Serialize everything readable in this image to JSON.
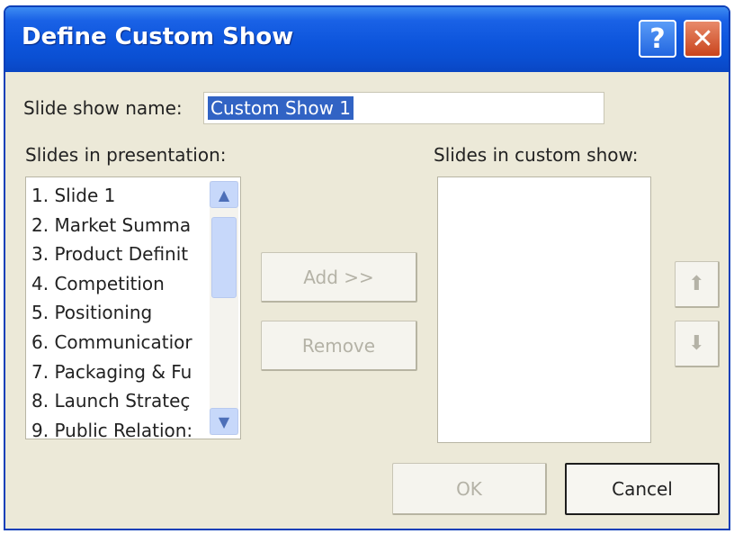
{
  "window": {
    "title": "Define Custom Show",
    "help_label": "?",
    "close_label": "✕"
  },
  "name_field": {
    "label": "Slide show name:",
    "value": "Custom Show 1"
  },
  "presentation": {
    "label": "Slides in presentation:",
    "items": [
      "1. Slide 1",
      "2. Market Summa",
      "3. Product Definit",
      "4. Competition",
      "5. Positioning",
      "6. Communicatior",
      "7. Packaging & Fu",
      "8. Launch Strateç",
      "9. Public Relation:"
    ]
  },
  "custom_show": {
    "label": "Slides in custom show:",
    "items": []
  },
  "buttons": {
    "add": "Add >>",
    "remove": "Remove",
    "ok": "OK",
    "cancel": "Cancel"
  },
  "icons": {
    "move_up": "up-arrow-icon",
    "move_down": "down-arrow-icon",
    "scroll_up": "chevron-up-icon",
    "scroll_down": "chevron-down-icon"
  },
  "colors": {
    "titlebar": "#0d55dc",
    "selection": "#3163c4",
    "dialog_bg": "#ece9d8"
  }
}
